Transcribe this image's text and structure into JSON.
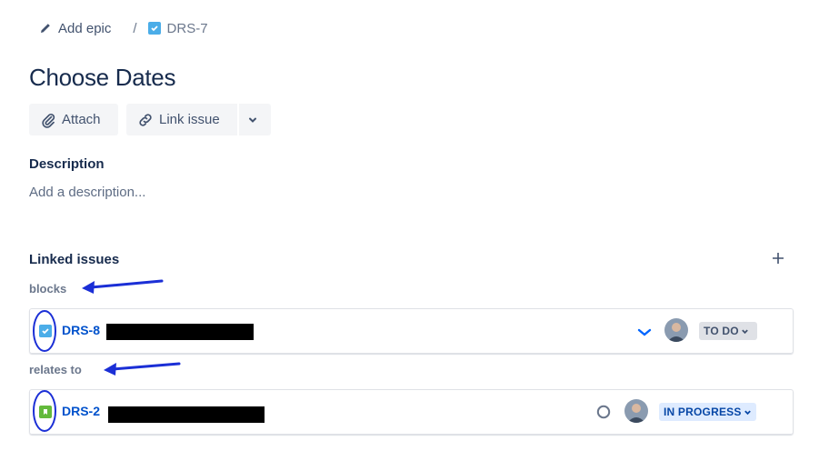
{
  "breadcrumb": {
    "add_epic": "Add epic",
    "separator": "/",
    "issue_key": "DRS-7"
  },
  "issue": {
    "title": "Choose Dates"
  },
  "toolbar": {
    "attach_label": "Attach",
    "link_issue_label": "Link issue"
  },
  "description": {
    "label": "Description",
    "placeholder": "Add a description..."
  },
  "linked_issues": {
    "label": "Linked issues",
    "groups": [
      {
        "relation": "blocks",
        "issues": [
          {
            "key": "DRS-8",
            "type_icon": "task-icon",
            "priority_icon": "chevron-down-icon",
            "status": "TO DO"
          }
        ]
      },
      {
        "relation": "relates to",
        "issues": [
          {
            "key": "DRS-2",
            "type_icon": "story-icon",
            "priority_icon": "circle-icon",
            "status": "IN PROGRESS"
          }
        ]
      }
    ]
  },
  "colors": {
    "task": "#4bade8",
    "story": "#63ba3c",
    "link": "#0052cc",
    "annotation": "#1b2fd6",
    "todo_bg": "#dfe1e6",
    "inprogress_bg": "#deebff"
  }
}
